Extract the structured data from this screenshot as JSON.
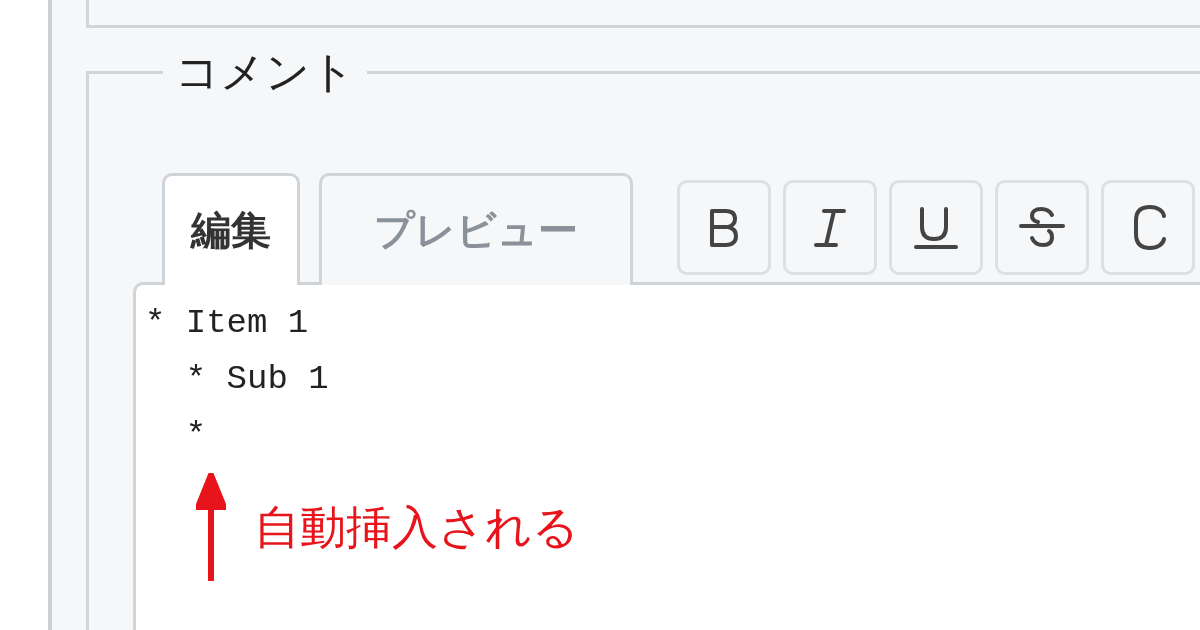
{
  "fieldset": {
    "legend": "コメント"
  },
  "tabs": [
    {
      "label": "編集",
      "selected": true
    },
    {
      "label": "プレビュー",
      "selected": false
    }
  ],
  "toolbar": [
    {
      "kind": "bold"
    },
    {
      "kind": "italic"
    },
    {
      "kind": "underline"
    },
    {
      "kind": "strikethrough"
    },
    {
      "kind": "code"
    }
  ],
  "editor": {
    "value": "* Item 1\n  * Sub 1\n  *"
  },
  "annotation": {
    "text": "自動挿入される"
  }
}
